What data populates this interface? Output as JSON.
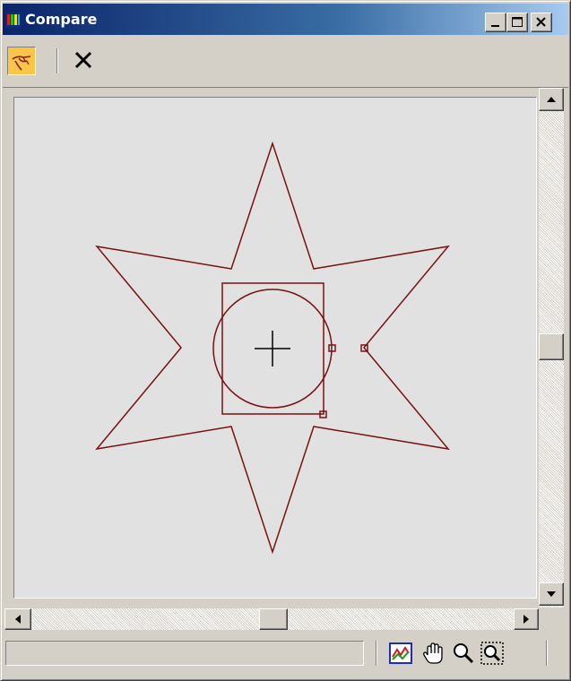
{
  "window": {
    "title": "Compare",
    "controls": [
      "minimize-icon",
      "maximize-icon",
      "close-icon"
    ]
  },
  "toolbar": {
    "tools": [
      {
        "name": "pick-curve-tool",
        "icon": "pick-hand-icon",
        "active": true
      },
      {
        "name": "delete-tool",
        "icon": "x-icon",
        "active": false
      }
    ]
  },
  "viewport": {
    "background": "#e1e1e1",
    "curve_color": "#7a1010",
    "shapes": [
      "six-point-star",
      "rectangle",
      "circle",
      "crosshair"
    ]
  },
  "status": {
    "text": "",
    "tools": [
      "zoom-extents-icon",
      "pan-hand-icon",
      "zoom-icon",
      "zoom-region-icon"
    ]
  },
  "colors": {
    "titlebar_start": "#0a246a",
    "titlebar_end": "#a6caf0",
    "active_tool": "#fbc54a"
  }
}
